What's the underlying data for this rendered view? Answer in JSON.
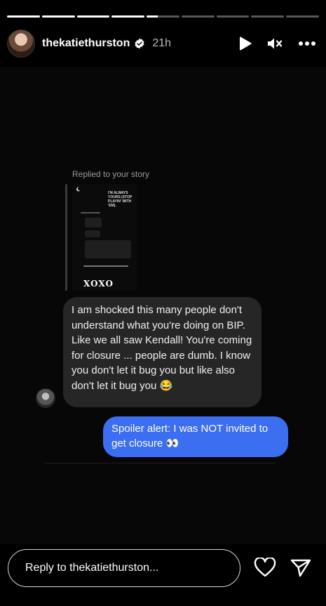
{
  "progress": {
    "segments": 9,
    "completed": 4,
    "current_fraction": 0.35
  },
  "header": {
    "username": "thekatiethurston",
    "verified": true,
    "time": "21h"
  },
  "message": {
    "replied_label": "Replied to your story",
    "thumbnail_text": {
      "headline": "I'M ALWAYS YOURS (STOP PLAYIN' WITH 'EM).",
      "signoff": "XOXO"
    },
    "incoming_text": "I am shocked this many people don't understand what you're doing on BIP. Like we all saw Kendall! You're coming for closure ... people are dumb. I know you don't let it bug you but like also don't let it bug you 😂",
    "outgoing_text": "Spoiler alert: I was NOT invited to get closure 👀"
  },
  "reply": {
    "placeholder": "Reply to thekatiethurston..."
  },
  "icons": {
    "play": "play-icon",
    "mute": "speaker-muted-icon",
    "more": "more-dots-icon",
    "heart": "heart-icon",
    "send": "send-icon",
    "verified": "verified-badge-icon"
  }
}
